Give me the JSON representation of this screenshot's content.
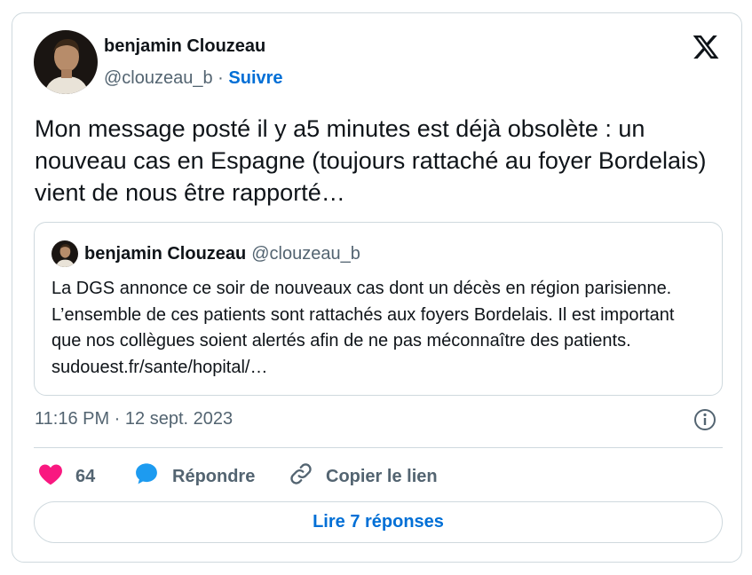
{
  "author": {
    "name": "benjamin Clouzeau",
    "handle": "@clouzeau_b",
    "separator": "·",
    "follow_label": "Suivre"
  },
  "tweet": {
    "text": "Mon message posté il y a5 minutes est déjà obsolète : un nouveau cas en Espagne (toujours rattaché au foyer Bordelais) vient de nous être rapporté…",
    "timestamp": "11:16 PM · 12 sept. 2023"
  },
  "quoted_tweet": {
    "name": "benjamin Clouzeau",
    "handle": "@clouzeau_b",
    "text": "La DGS annonce ce soir de nouveaux cas dont un décès en région parisienne. L’ensemble de ces patients sont rattachés aux foyers Bordelais. Il est important que nos collègues soient alertés afin de ne pas méconnaître des patients. sudouest.fr/sante/hopital/…"
  },
  "actions": {
    "like_count": "64",
    "reply_label": "Répondre",
    "copy_link_label": "Copier le lien"
  },
  "read_replies_label": "Lire 7 réponses",
  "colors": {
    "accent": "#006fd6",
    "like": "#f91880",
    "reply": "#1d9bf0",
    "muted": "#536471",
    "border": "#cfd9de"
  },
  "icons": {
    "brand": "x-logo-icon",
    "info": "info-icon",
    "like": "heart-icon",
    "reply": "speech-bubble-icon",
    "copy": "link-icon"
  }
}
